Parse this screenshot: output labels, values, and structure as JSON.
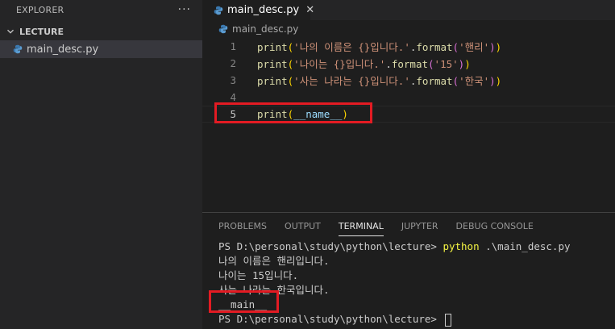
{
  "sidebar": {
    "header": "EXPLORER",
    "more_icon": "ellipsis-icon",
    "folder_name": "LECTURE",
    "file_name": "main_desc.py"
  },
  "editor": {
    "tab_label": "main_desc.py",
    "tab_close": "✕",
    "breadcrumb": "main_desc.py",
    "lines": [
      {
        "num": "1",
        "fn": "print",
        "open": "(",
        "str": "'나의 이름은 {}입니다.'",
        "dot": ".",
        "method": "format",
        "open2": "(",
        "arg": "'핸리'",
        "close2": ")",
        "close": ")"
      },
      {
        "num": "2",
        "fn": "print",
        "open": "(",
        "str": "'나이는 {}입니다.'",
        "dot": ".",
        "method": "format",
        "open2": "(",
        "arg": "'15'",
        "close2": ")",
        "close": ")"
      },
      {
        "num": "3",
        "fn": "print",
        "open": "(",
        "str": "'사는 나라는 {}입니다.'",
        "dot": ".",
        "method": "format",
        "open2": "(",
        "arg": "'한국'",
        "close2": ")",
        "close": ")"
      },
      {
        "num": "4"
      },
      {
        "num": "5",
        "fn": "print",
        "open": "(",
        "var": "__name__",
        "close": ")"
      }
    ]
  },
  "panel": {
    "tabs": [
      "PROBLEMS",
      "OUTPUT",
      "TERMINAL",
      "JUPYTER",
      "DEBUG CONSOLE"
    ],
    "terminal": {
      "prompt1": "PS D:\\personal\\study\\python\\lecture> ",
      "cmd_kw": "python",
      "cmd_arg": " .\\main_desc.py",
      "out1": "나의 이름은 핸리입니다.",
      "out2": "나이는 15입니다.",
      "out3": "사는 나라는 한국입니다.",
      "out4": "__main__",
      "prompt2": "PS D:\\personal\\study\\python\\lecture> "
    }
  },
  "colors": {
    "highlight_box": "#e31b23",
    "editor_bg": "#1e1e1e",
    "sidebar_bg": "#252526"
  }
}
